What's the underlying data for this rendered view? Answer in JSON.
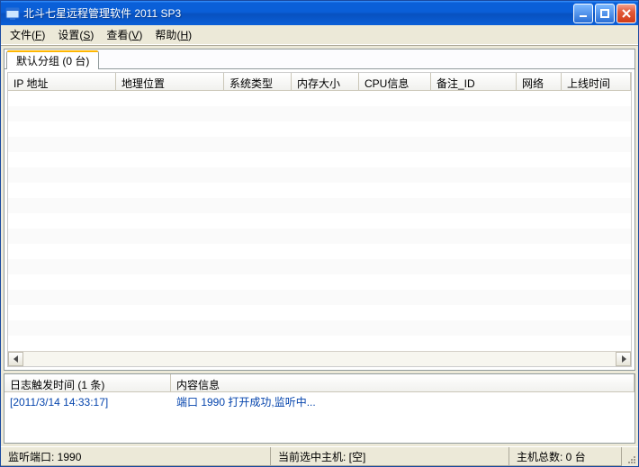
{
  "window": {
    "title": "北斗七星远程管理软件 2011 SP3"
  },
  "menu": {
    "file": {
      "label": "文件",
      "accel": "F"
    },
    "settings": {
      "label": "设置",
      "accel": "S"
    },
    "view": {
      "label": "查看",
      "accel": "V"
    },
    "help": {
      "label": "帮助",
      "accel": "H"
    }
  },
  "tabs": {
    "default_group": "默认分组 (0 台)"
  },
  "columns": {
    "ip": "IP 地址",
    "location": "地理位置",
    "os": "系统类型",
    "memory": "内存大小",
    "cpu": "CPU信息",
    "note_id": "备注_ID",
    "network": "网络",
    "online_time": "上线时间"
  },
  "hosts": [],
  "log_columns": {
    "time": "日志触发时间 (1 条)",
    "content": "内容信息"
  },
  "logs": [
    {
      "time": "[2011/3/14 14:33:17]",
      "content": "端口 1990 打开成功,监听中..."
    }
  ],
  "status": {
    "port": "监听端口: 1990",
    "selected": "当前选中主机: [空]",
    "total": "主机总数: 0 台"
  }
}
